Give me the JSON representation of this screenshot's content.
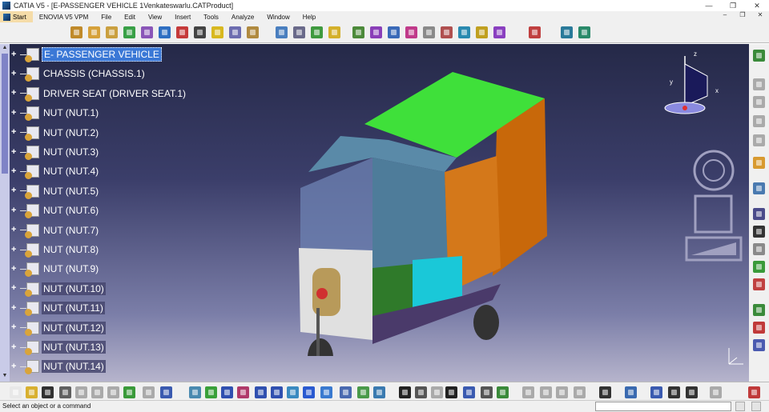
{
  "window": {
    "title": "CATIA V5 - [E-PASSENGER VEHICLE 1Venkateswarlu.CATProduct]",
    "buttons": [
      "—",
      "❐",
      "✕"
    ]
  },
  "menu": {
    "items": [
      "Start",
      "ENOVIA V5 VPM",
      "File",
      "Edit",
      "View",
      "Insert",
      "Tools",
      "Analyze",
      "Window",
      "Help"
    ],
    "doc_buttons": [
      "–",
      "❐",
      "✕"
    ]
  },
  "toolbar_top": {
    "icons": [
      [
        "assembly-manager-icon",
        "#c08a2a",
        88
      ],
      [
        "new-component-icon",
        "#d6a13a",
        110
      ],
      [
        "new-product-icon",
        "#caa040",
        132
      ],
      [
        "new-part-icon",
        "#39a047",
        154
      ],
      [
        "existing-component-icon",
        "#8a56b8",
        176
      ],
      [
        "replace-component-icon",
        "#2f6fc2",
        198
      ],
      [
        "graph-tree-icon",
        "#c53a3a",
        220
      ],
      [
        "generate-numbering-icon",
        "#444444",
        242
      ],
      [
        "selective-load-icon",
        "#d8b820",
        264
      ],
      [
        "manage-representations-icon",
        "#6d6db0",
        286
      ],
      [
        "multi-instantiation-icon",
        "#b08a40",
        308
      ],
      [
        "manipulation-icon",
        "#4a7fbf",
        344
      ],
      [
        "snap-icon",
        "#6a6a8a",
        366
      ],
      [
        "explode-icon",
        "#3f9a3f",
        388
      ],
      [
        "clash-icon",
        "#d4b02a",
        410
      ],
      [
        "coincidence-constraint-icon",
        "#4c8a3a",
        440
      ],
      [
        "contact-constraint-icon",
        "#8a3fb8",
        462
      ],
      [
        "offset-constraint-icon",
        "#3a6ab8",
        484
      ],
      [
        "angle-constraint-icon",
        "#c03a8a",
        506
      ],
      [
        "fix-component-icon",
        "#8a8a8a",
        528
      ],
      [
        "fix-together-icon",
        "#b05050",
        550
      ],
      [
        "quick-constraint-icon",
        "#2a8ab0",
        572
      ],
      [
        "flexible-subassembly-icon",
        "#c0a020",
        594
      ],
      [
        "reuse-pattern-icon",
        "#8a40c0",
        616
      ],
      [
        "update-icon",
        "#c04040",
        660
      ],
      [
        "scene-icon",
        "#2a7a9a",
        700
      ],
      [
        "enhanced-scene-icon",
        "#2a8a6a",
        722
      ]
    ]
  },
  "toolbar_bottom": {
    "icons": [
      [
        "new-icon",
        "#e8e8e8",
        12
      ],
      [
        "open-icon",
        "#d8b030",
        32
      ],
      [
        "save-icon",
        "#303030",
        52
      ],
      [
        "print-icon",
        "#606060",
        74
      ],
      [
        "cut-icon",
        "#aaaaaa",
        94
      ],
      [
        "copy-icon",
        "#aaaaaa",
        114
      ],
      [
        "paste-icon",
        "#aaaaaa",
        134
      ],
      [
        "undo-icon",
        "#3a9a3a",
        154
      ],
      [
        "redo-icon",
        "#aaaaaa",
        178
      ],
      [
        "whats-this-icon",
        "#3a5ab0",
        200
      ],
      [
        "fly-mode-icon",
        "#4a8ab0",
        236
      ],
      [
        "fit-all-icon",
        "#3aa03a",
        256
      ],
      [
        "pan-icon",
        "#3050b0",
        276
      ],
      [
        "rotate-icon",
        "#b03a6a",
        296
      ],
      [
        "zoom-in-icon",
        "#3050b0",
        318
      ],
      [
        "zoom-out-icon",
        "#3050b0",
        338
      ],
      [
        "normal-view-icon",
        "#3a8ac0",
        358
      ],
      [
        "multi-view-icon",
        "#2a5ad0",
        378
      ],
      [
        "isometric-view-icon",
        "#3a7ad0",
        400
      ],
      [
        "shading-icon",
        "#4a6ab0",
        424
      ],
      [
        "hide-show-icon",
        "#4a9a4a",
        446
      ],
      [
        "swap-space-icon",
        "#3a7ab0",
        466
      ],
      [
        "formula-icon",
        "#222222",
        498
      ],
      [
        "comment-icon",
        "#555555",
        518
      ],
      [
        "knowledge-icon",
        "#aaaaaa",
        538
      ],
      [
        "table-icon",
        "#222222",
        556
      ],
      [
        "tree-icon",
        "#3a5ab0",
        578
      ],
      [
        "lock-icon",
        "#555555",
        600
      ],
      [
        "parameters-icon",
        "#3a8a3a",
        620
      ],
      [
        "measure-between-icon",
        "#aaaaaa",
        652
      ],
      [
        "measure-item-icon",
        "#aaaaaa",
        674
      ],
      [
        "measure-inertia-icon",
        "#aaaaaa",
        694
      ],
      [
        "analysis-icon",
        "#aaaaaa",
        716
      ],
      [
        "capture-icon",
        "#333333",
        748
      ],
      [
        "catalog-icon",
        "#3a6ab0",
        780
      ],
      [
        "distance-band-icon",
        "#3a5ab0",
        812
      ],
      [
        "sectioning-icon",
        "#333333",
        834
      ],
      [
        "thermometer-icon",
        "#333333",
        856
      ],
      [
        "constraint-analysis-icon",
        "#aaaaaa",
        886
      ],
      [
        "catia-logo-icon",
        "#c03a3a",
        934
      ]
    ]
  },
  "toolbar_right": {
    "icons": [
      [
        "assembly-features-icon",
        "#3a8a3a",
        62
      ],
      [
        "split-icon",
        "#aaaaaa",
        98
      ],
      [
        "hole-icon",
        "#aaaaaa",
        120
      ],
      [
        "pocket-icon",
        "#aaaaaa",
        144
      ],
      [
        "add-icon",
        "#aaaaaa",
        168
      ],
      [
        "select-icon",
        "#d89a30",
        196
      ],
      [
        "view-component-icon",
        "#4a7ab0",
        228
      ],
      [
        "sectioning-right-icon",
        "#4a4a8a",
        260
      ],
      [
        "annotation-icon",
        "#333333",
        282
      ],
      [
        "weld-icon",
        "#8a8a8a",
        304
      ],
      [
        "scene-right-icon",
        "#3a9a3a",
        326
      ],
      [
        "publish-icon",
        "#c04040",
        348
      ],
      [
        "bom-icon",
        "#3a8a3a",
        380
      ],
      [
        "compare-icon",
        "#c03a3a",
        402
      ],
      [
        "report-icon",
        "#4a5ab0",
        424
      ]
    ]
  },
  "tree": {
    "root": "E- PASSENGER VEHICLE",
    "items": [
      "CHASSIS (CHASSIS.1)",
      "DRIVER SEAT (DRIVER SEAT.1)",
      "NUT (NUT.1)",
      "NUT (NUT.2)",
      "NUT (NUT.3)",
      "NUT (NUT.4)",
      "NUT (NUT.5)",
      "NUT (NUT.6)",
      "NUT (NUT.7)",
      "NUT (NUT.8)",
      "NUT (NUT.9)",
      "NUT (NUT.10)",
      "NUT (NUT.11)",
      "NUT (NUT.12)",
      "NUT (NUT.13)",
      "NUT (NUT.14)"
    ],
    "highlighted_from": 11
  },
  "compass": {
    "labels": [
      "z",
      "x",
      "y"
    ]
  },
  "status": {
    "message": "Select an object or a command",
    "command_input": ""
  }
}
